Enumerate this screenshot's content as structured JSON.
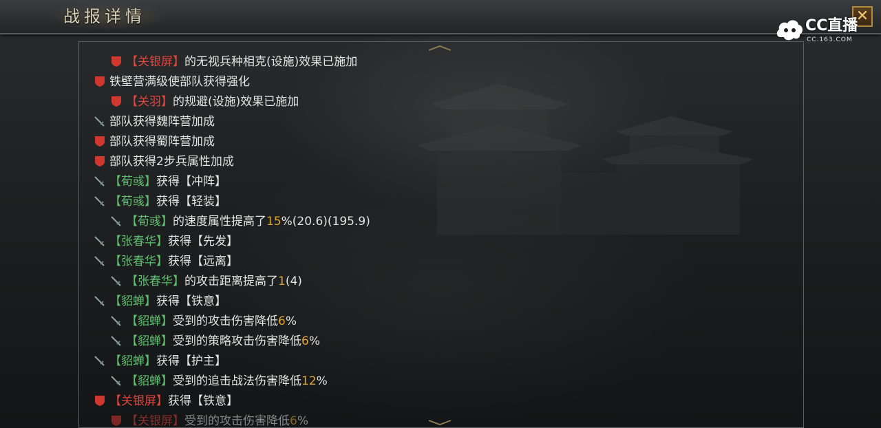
{
  "header": {
    "title": "战报详情",
    "close_label": "✕"
  },
  "watermark": {
    "brand": "CC直播",
    "url": "CC.163.COM"
  },
  "colors": {
    "red_shield": "#d0372f",
    "green_name": "#5fbf6e",
    "red_name": "#e0463e",
    "number": "#d9a532",
    "text": "#e4e4e2"
  },
  "log": [
    {
      "icon": "red-shield-icon",
      "name": "【关银屏】",
      "name_color": "red",
      "parts": [
        {
          "t": "的无视兵种相克(设施)效果已施加"
        }
      ]
    },
    {
      "icon": "red-shield-icon",
      "name": "",
      "name_color": "",
      "parts": [
        {
          "t": "铁壁营满级使部队获得强化"
        }
      ]
    },
    {
      "icon": "red-shield-icon",
      "name": "【关羽】",
      "name_color": "red",
      "parts": [
        {
          "t": "的规避(设施)效果已施加"
        }
      ]
    },
    {
      "icon": "sword-icon",
      "name": "",
      "name_color": "",
      "parts": [
        {
          "t": "部队获得魏阵营加成"
        }
      ]
    },
    {
      "icon": "red-shield-icon",
      "name": "",
      "name_color": "",
      "parts": [
        {
          "t": "部队获得蜀阵营加成"
        }
      ]
    },
    {
      "icon": "red-shield-icon",
      "name": "",
      "name_color": "",
      "parts": [
        {
          "t": "部队获得2步兵属性加成"
        }
      ]
    },
    {
      "icon": "sword-icon",
      "name": "【荀彧】",
      "name_color": "green",
      "parts": [
        {
          "t": "获得【冲阵】"
        }
      ]
    },
    {
      "icon": "sword-icon",
      "name": "【荀彧】",
      "name_color": "green",
      "parts": [
        {
          "t": "获得【轻装】"
        }
      ]
    },
    {
      "icon": "sword-icon",
      "name": "【荀彧】",
      "name_color": "green",
      "parts": [
        {
          "t": "的速度属性提高了"
        },
        {
          "n": "15"
        },
        {
          "t": "%(20.6)(195.9)"
        }
      ]
    },
    {
      "icon": "sword-icon",
      "name": "【张春华】",
      "name_color": "green",
      "parts": [
        {
          "t": "获得【先发】"
        }
      ]
    },
    {
      "icon": "sword-icon",
      "name": "【张春华】",
      "name_color": "green",
      "parts": [
        {
          "t": "获得【远离】"
        }
      ]
    },
    {
      "icon": "sword-icon",
      "name": "【张春华】",
      "name_color": "green",
      "parts": [
        {
          "t": "的攻击距离提高了"
        },
        {
          "n": "1"
        },
        {
          "t": "(4)"
        }
      ]
    },
    {
      "icon": "sword-icon",
      "name": "【貂蝉】",
      "name_color": "green",
      "parts": [
        {
          "t": "获得【铁意】"
        }
      ]
    },
    {
      "icon": "sword-icon",
      "name": "【貂蝉】",
      "name_color": "green",
      "parts": [
        {
          "t": "受到的攻击伤害降低"
        },
        {
          "n": "6"
        },
        {
          "t": "%"
        }
      ]
    },
    {
      "icon": "sword-icon",
      "name": "【貂蝉】",
      "name_color": "green",
      "parts": [
        {
          "t": "受到的策略攻击伤害降低"
        },
        {
          "n": "6"
        },
        {
          "t": "%"
        }
      ]
    },
    {
      "icon": "sword-icon",
      "name": "【貂蝉】",
      "name_color": "green",
      "parts": [
        {
          "t": "获得【护主】"
        }
      ]
    },
    {
      "icon": "sword-icon",
      "name": "【貂蝉】",
      "name_color": "green",
      "parts": [
        {
          "t": "受到的追击战法伤害降低"
        },
        {
          "n": "12"
        },
        {
          "t": "%"
        }
      ]
    },
    {
      "icon": "red-shield-icon",
      "name": "【关银屏】",
      "name_color": "red",
      "parts": [
        {
          "t": "获得【铁意】"
        }
      ]
    },
    {
      "icon": "red-shield-icon",
      "name": "【关银屏】",
      "name_color": "red",
      "parts": [
        {
          "t": "受到的攻击伤害降低"
        },
        {
          "n": "6"
        },
        {
          "t": "%"
        }
      ]
    }
  ]
}
